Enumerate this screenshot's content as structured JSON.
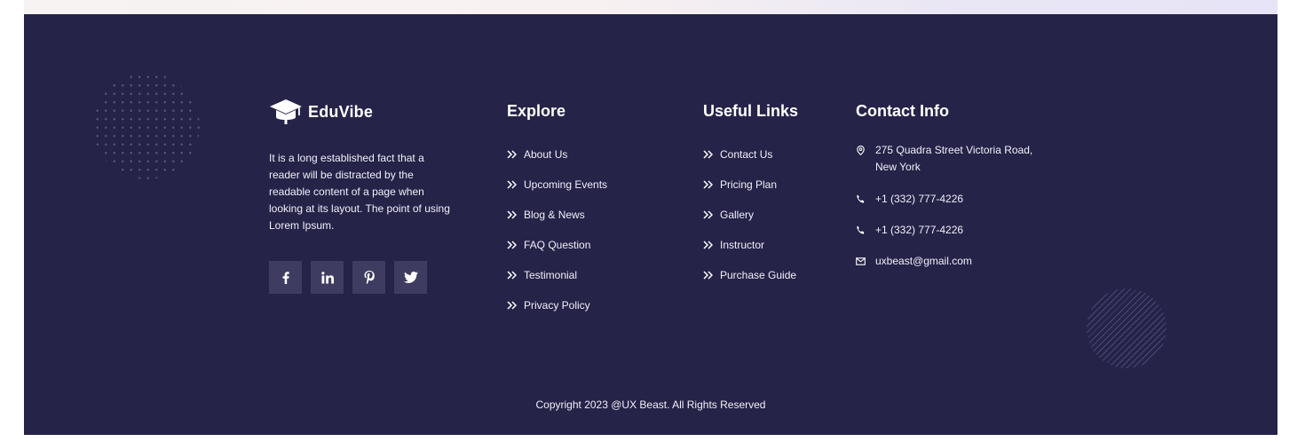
{
  "brand": {
    "name": "EduVibe",
    "logo_icon": "graduation-cap-icon"
  },
  "about": {
    "text": "It is a long established fact that a reader will be distracted by the readable content of a page when looking at its layout. The point of using Lorem Ipsum."
  },
  "socials": [
    {
      "icon": "facebook-icon"
    },
    {
      "icon": "linkedin-icon"
    },
    {
      "icon": "pinterest-icon"
    },
    {
      "icon": "twitter-icon"
    }
  ],
  "explore": {
    "title": "Explore",
    "items": [
      "About Us",
      "Upcoming Events",
      "Blog & News",
      "FAQ Question",
      "Testimonial",
      "Privacy Policy"
    ]
  },
  "useful_links": {
    "title": "Useful Links",
    "items": [
      "Contact Us",
      "Pricing Plan",
      "Gallery",
      "Instructor",
      "Purchase Guide"
    ]
  },
  "contact": {
    "title": "Contact Info",
    "address_line1": "275 Quadra Street Victoria Road,",
    "address_line2": "New York",
    "phone1": "+1 (332) 777-4226",
    "phone2": "+1 (332) 777-4226",
    "email": "uxbeast@gmail.com"
  },
  "copyright": "Copyright 2023 @UX Beast. All Rights Reserved",
  "colors": {
    "footer_bg": "#252348",
    "social_bg": "#3e3c60",
    "text": "#ffffff"
  }
}
